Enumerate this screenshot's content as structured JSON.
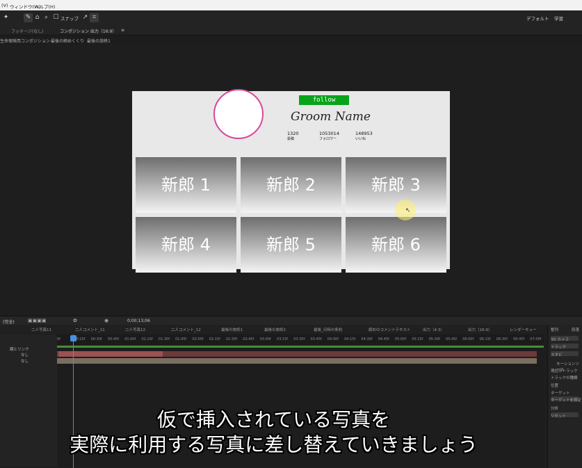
{
  "menu": {
    "item1": "(V)",
    "item2": "ウィンドウ(W)",
    "item3": "ヘルプ(H)"
  },
  "toolbar": {
    "snap_label": "スナップ",
    "workspace_default": "デフォルト",
    "workspace_learn": "学習"
  },
  "panel_tabs": {
    "footage": "フッテージ(なし)",
    "composition": "コンポジション 出力（16:9）",
    "menu_glyph": "≡"
  },
  "breadcrumb": [
    "生命保険用コンポジション",
    "最後の締めくくり",
    "最後の旅終1"
  ],
  "canvas": {
    "follow_label": "follow",
    "profile_name": "Groom Name",
    "stats": [
      {
        "value": "1320",
        "label": "投稿"
      },
      {
        "value": "1053014",
        "label": "フォロワー"
      },
      {
        "value": "148953",
        "label": "いいね"
      }
    ],
    "tiles": [
      "新郎 1",
      "新郎 2",
      "新郎 3",
      "新郎 4",
      "新郎 5",
      "新郎 6"
    ]
  },
  "timeline": {
    "timecode": "0;00;13;06",
    "zoom_label": "(完全)",
    "layer_header": "親とリンク",
    "parent_value": "なし",
    "tabs": [
      "二人写真11",
      "二人コメント_11",
      "二人写真12",
      "二人コメント_12",
      "最後の旅終1",
      "最後の旅終2",
      "最後_日時の条約",
      "締めのコメントテキスト",
      "出力（4:3）",
      "出力（16:9）",
      "レンダーキュー"
    ],
    "ruler": [
      "0f",
      "00:15f",
      "00:30f",
      "00:45f",
      "01:00f",
      "01:15f",
      "01:30f",
      "01:45f",
      "02:00f",
      "02:15f",
      "02:30f",
      "02:45f",
      "03:00f",
      "03:15f",
      "03:30f",
      "03:45f",
      "04:00f",
      "04:15f",
      "04:30f",
      "04:45f",
      "05:00f",
      "05:15f",
      "05:30f",
      "05:45f",
      "06:00f",
      "06:15f",
      "06:30f",
      "06:45f",
      "07:00f"
    ]
  },
  "right_panel": {
    "title1": "整列",
    "title2": "段落",
    "item1": "3D カメラ",
    "item2": "トラック",
    "item3": "スタビ",
    "item4": "モーションソース",
    "item5": "現在のトラック",
    "item6": "トラックの種類",
    "item7": "位置",
    "item8": "ターゲット",
    "item9": "ターゲットを設定",
    "item10": "分析",
    "item11": "リセット"
  },
  "subtitle": {
    "line1": "仮で挿入されている写真を",
    "line2": "実際に利用する写真に差し替えていきましょう"
  }
}
